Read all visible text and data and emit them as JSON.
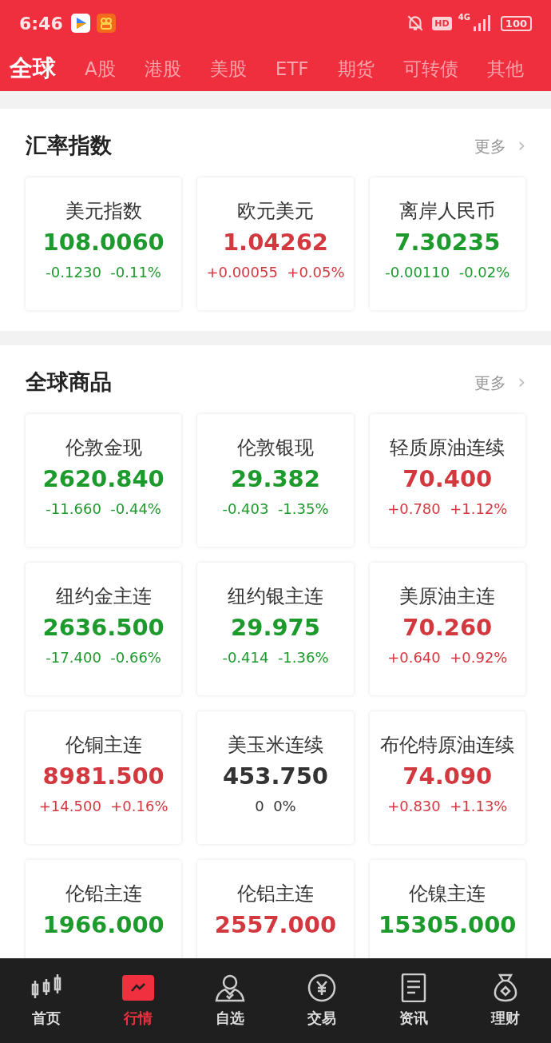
{
  "status_bar": {
    "time": "6:46",
    "hd": "HD",
    "network": "4G",
    "battery": "100"
  },
  "tabs": [
    {
      "label": "全球",
      "selected": true
    },
    {
      "label": "A股",
      "selected": false
    },
    {
      "label": "港股",
      "selected": false
    },
    {
      "label": "美股",
      "selected": false
    },
    {
      "label": "ETF",
      "selected": false
    },
    {
      "label": "期货",
      "selected": false
    },
    {
      "label": "可转债",
      "selected": false
    },
    {
      "label": "其他",
      "selected": false
    }
  ],
  "sections": [
    {
      "title": "汇率指数",
      "more": "更多",
      "more_arrow": "›",
      "cards": [
        {
          "name": "美元指数",
          "price": "108.0060",
          "change": "-0.1230",
          "percent": "-0.11%",
          "color": "#1c9a2c"
        },
        {
          "name": "欧元美元",
          "price": "1.04262",
          "change": "+0.00055",
          "percent": "+0.05%",
          "color": "#d3383f"
        },
        {
          "name": "离岸人民币",
          "price": "7.30235",
          "change": "-0.00110",
          "percent": "-0.02%",
          "color": "#1c9a2c"
        }
      ]
    },
    {
      "title": "全球商品",
      "more": "更多",
      "more_arrow": "›",
      "cards": [
        {
          "name": "伦敦金现",
          "price": "2620.840",
          "change": "-11.660",
          "percent": "-0.44%",
          "color": "#1c9a2c"
        },
        {
          "name": "伦敦银现",
          "price": "29.382",
          "change": "-0.403",
          "percent": "-1.35%",
          "color": "#1c9a2c"
        },
        {
          "name": "轻质原油连续",
          "price": "70.400",
          "change": "+0.780",
          "percent": "+1.12%",
          "color": "#d3383f"
        },
        {
          "name": "纽约金主连",
          "price": "2636.500",
          "change": "-17.400",
          "percent": "-0.66%",
          "color": "#1c9a2c"
        },
        {
          "name": "纽约银主连",
          "price": "29.975",
          "change": "-0.414",
          "percent": "-1.36%",
          "color": "#1c9a2c"
        },
        {
          "name": "美原油主连",
          "price": "70.260",
          "change": "+0.640",
          "percent": "+0.92%",
          "color": "#d3383f"
        },
        {
          "name": "伦铜主连",
          "price": "8981.500",
          "change": "+14.500",
          "percent": "+0.16%",
          "color": "#d3383f"
        },
        {
          "name": "美玉米连续",
          "price": "453.750",
          "change": "0",
          "percent": "0%",
          "color": "#333333"
        },
        {
          "name": "布伦特原油连续",
          "price": "74.090",
          "change": "+0.830",
          "percent": "+1.13%",
          "color": "#d3383f"
        },
        {
          "name": "伦铅主连",
          "price": "1966.000",
          "color": "#1c9a2c"
        },
        {
          "name": "伦铝主连",
          "price": "2557.000",
          "color": "#d3383f"
        },
        {
          "name": "伦镍主连",
          "price": "15305.000",
          "color": "#1c9a2c"
        }
      ]
    }
  ],
  "nav": [
    {
      "label": "首页",
      "selected": false
    },
    {
      "label": "行情",
      "selected": true
    },
    {
      "label": "自选",
      "selected": false
    },
    {
      "label": "交易",
      "selected": false
    },
    {
      "label": "资讯",
      "selected": false
    },
    {
      "label": "理财",
      "selected": false
    }
  ]
}
